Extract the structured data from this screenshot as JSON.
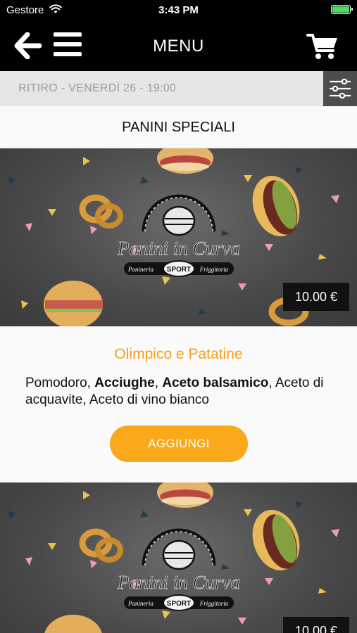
{
  "status_bar": {
    "carrier": "Gestore",
    "time": "3:43 PM",
    "battery_color": "#4cd964"
  },
  "nav": {
    "title": "MENU",
    "back_icon": "arrow-left-icon",
    "menu_icon": "hamburger-icon",
    "cart_icon": "cart-icon"
  },
  "pickup": {
    "text": "RITIRO - VENERDÌ 26 - 19:00",
    "filter_icon": "sliders-icon"
  },
  "section": {
    "title": "PANINI SPECIALI"
  },
  "products": [
    {
      "image_logo": {
        "brand": "Panini in Curva",
        "left": "Panineria",
        "center": "SPORT",
        "right": "Friggitoria"
      },
      "price": "10.00 €",
      "name": "Olimpico e Patatine",
      "ingredients": [
        {
          "text": "Pomodoro",
          "bold": false
        },
        {
          "text": ", ",
          "bold": false
        },
        {
          "text": "Acciughe",
          "bold": true
        },
        {
          "text": ", ",
          "bold": false
        },
        {
          "text": "Aceto balsamico",
          "bold": true
        },
        {
          "text": ", Aceto di acquavite, Aceto di vino bianco",
          "bold": false
        }
      ],
      "add_label": "AGGIUNGI"
    },
    {
      "image_logo": {
        "brand": "Panini in Curva",
        "left": "Panineria",
        "center": "SPORT",
        "right": "Friggitoria"
      },
      "price": "10.00 €"
    }
  ],
  "colors": {
    "accent": "#fba81b",
    "product_name": "#f4a11d",
    "bar_background": "#000000"
  }
}
